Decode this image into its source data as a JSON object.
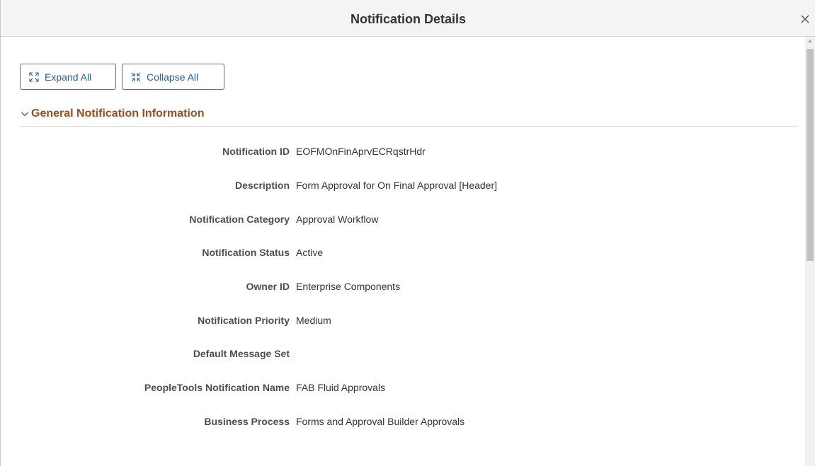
{
  "dialog": {
    "title": "Notification Details"
  },
  "toolbar": {
    "expand_label": "Expand All",
    "collapse_label": "Collapse All"
  },
  "section": {
    "title": "General Notification Information"
  },
  "fields": [
    {
      "label": "Notification ID",
      "value": "EOFMOnFinAprvECRqstrHdr"
    },
    {
      "label": "Description",
      "value": "Form Approval for On Final Approval [Header]"
    },
    {
      "label": "Notification Category",
      "value": "Approval Workflow"
    },
    {
      "label": "Notification Status",
      "value": "Active"
    },
    {
      "label": "Owner ID",
      "value": "Enterprise Components"
    },
    {
      "label": "Notification Priority",
      "value": "Medium"
    },
    {
      "label": "Default Message Set",
      "value": ""
    },
    {
      "label": "PeopleTools Notification Name",
      "value": "FAB Fluid Approvals"
    },
    {
      "label": "Business Process",
      "value": "Forms and Approval Builder Approvals"
    }
  ],
  "colors": {
    "link_blue": "#1f5f9e",
    "section_title": "#9a4d1d",
    "label_gray": "#4d4d4d"
  }
}
